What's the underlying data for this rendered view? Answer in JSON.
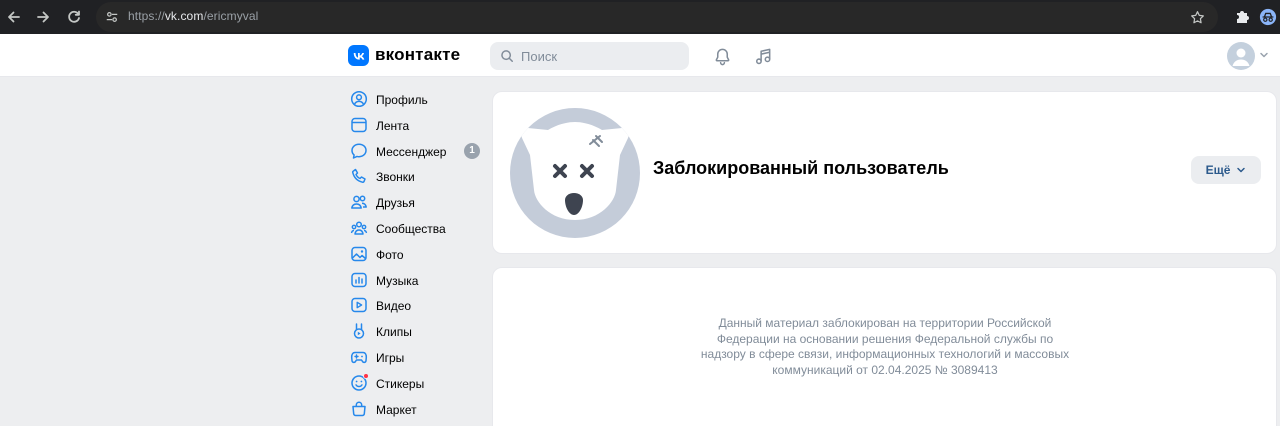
{
  "browser": {
    "url_scheme": "https://",
    "url_host": "vk.com",
    "url_path": "/ericmyval"
  },
  "header": {
    "logo_text": "вконтакте",
    "search_placeholder": "Поиск"
  },
  "sidebar": {
    "items": [
      {
        "label": "Профиль",
        "icon": "user-circle-icon"
      },
      {
        "label": "Лента",
        "icon": "feed-icon"
      },
      {
        "label": "Мессенджер",
        "icon": "message-icon",
        "badge": "1"
      },
      {
        "label": "Звонки",
        "icon": "phone-icon"
      },
      {
        "label": "Друзья",
        "icon": "friends-icon"
      },
      {
        "label": "Сообщества",
        "icon": "communities-icon"
      },
      {
        "label": "Фото",
        "icon": "photo-icon"
      },
      {
        "label": "Музыка",
        "icon": "music-icon"
      },
      {
        "label": "Видео",
        "icon": "video-icon"
      },
      {
        "label": "Клипы",
        "icon": "clips-icon"
      },
      {
        "label": "Игры",
        "icon": "gamepad-icon"
      },
      {
        "label": "Стикеры",
        "icon": "sticker-icon",
        "dot": true
      },
      {
        "label": "Маркет",
        "icon": "market-bag-icon"
      }
    ]
  },
  "profile": {
    "name": "Заблокированный пользователь",
    "more_label": "Ещё"
  },
  "notice": {
    "text": "Данный материал заблокирован на территории Российской Федерации на основании решения Федеральной службы по надзору в сфере связи, информационных технологий и массовых коммуникаций от 02.04.2025 № 3089413"
  },
  "colors": {
    "accent": "#0077ff",
    "page_bg": "#edeef0",
    "muted_text": "#818c99",
    "badge_bg": "#99a2ad",
    "sidebar_icon": "#2688eb"
  }
}
